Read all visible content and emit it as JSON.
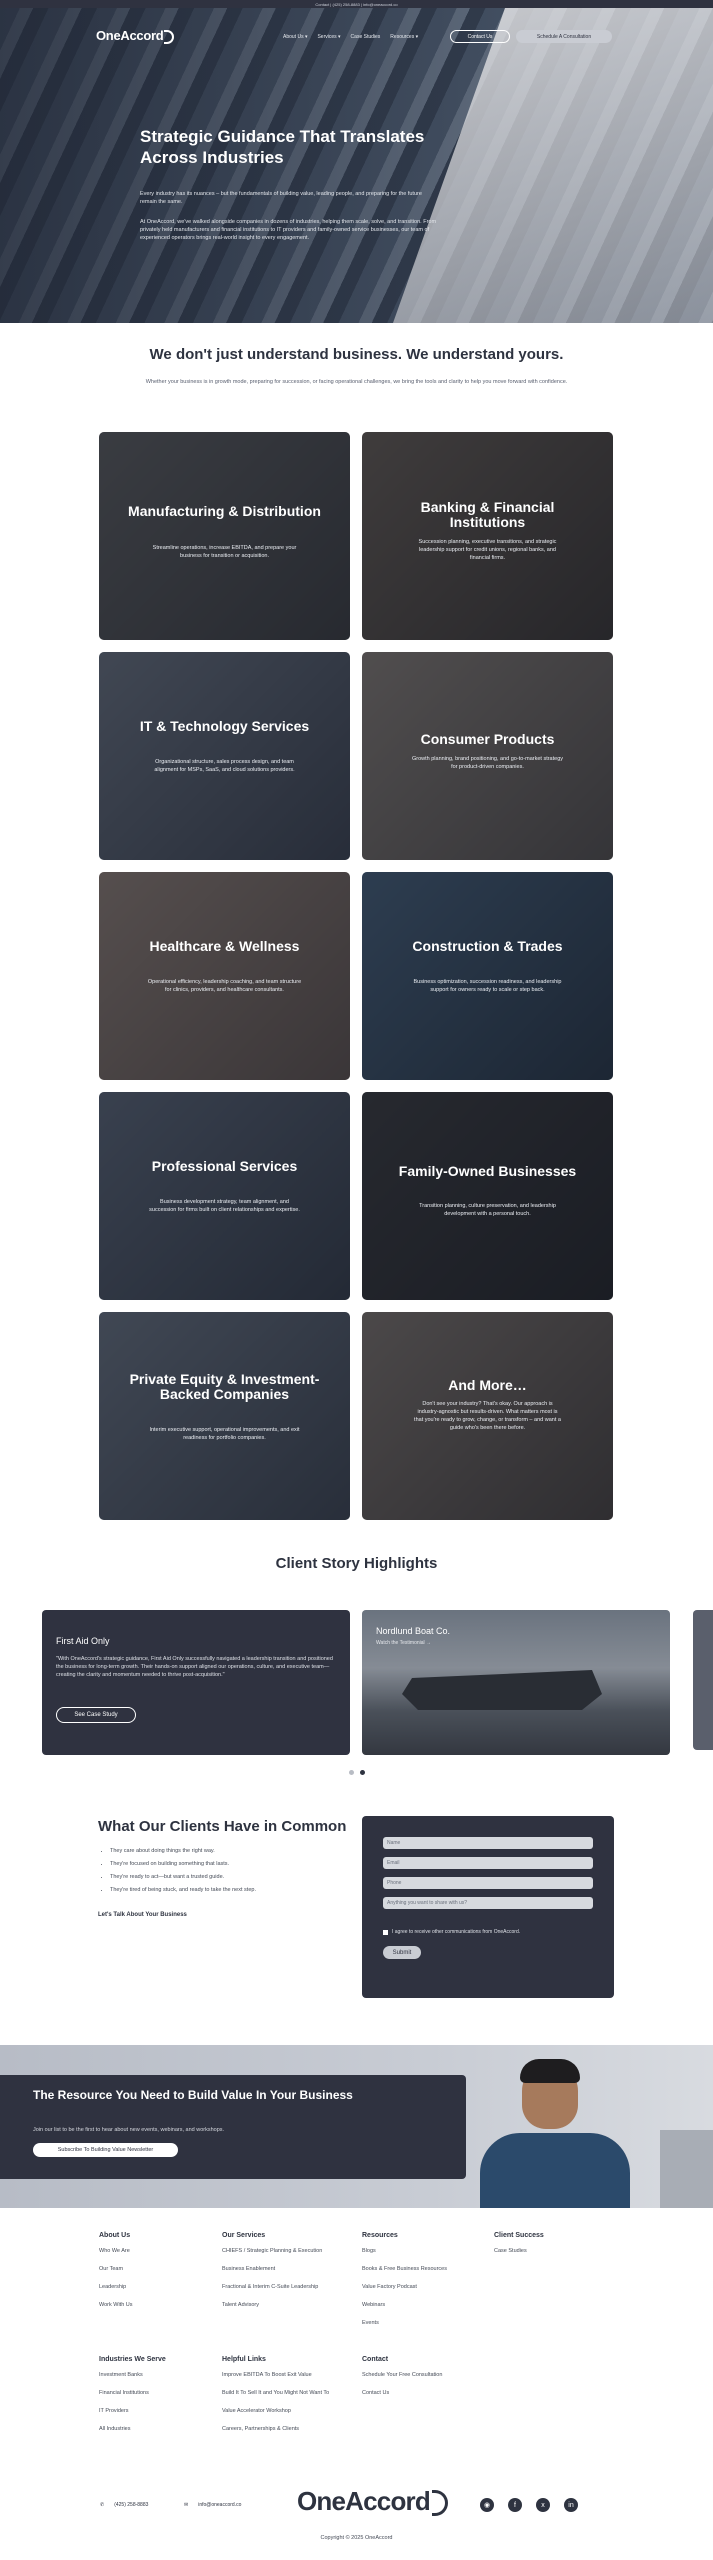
{
  "topbar": {
    "text": "Contact | (425) 258-8883 | info@oneaccord.co"
  },
  "nav": {
    "logo": "OneAccord",
    "links": [
      "About Us ▾",
      "Services ▾",
      "Case Studies",
      "Resources ▾"
    ],
    "contact_label": "Contact Us",
    "schedule_label": "Schedule A Consultation"
  },
  "hero": {
    "title": "Strategic Guidance That Translates Across Industries",
    "p1": "Every industry has its nuances – but the fundamentals of building value, leading people, and preparing for the future remain the same.",
    "p2": "At OneAccord, we've walked alongside companies in dozens of industries, helping them scale, solve, and transition. From privately held manufacturers and financial institutions to IT providers and family-owned service businesses, our team of experienced operators brings real-world insight to every engagement."
  },
  "intro": {
    "title": "We don't just understand business. We understand yours.",
    "text": "Whether your business is in growth mode, preparing for succession, or facing operational challenges, we bring the tools and clarity to help you move forward with confidence."
  },
  "industries": [
    {
      "title": "Manufacturing & Distribution",
      "desc": "Streamline operations, increase EBITDA, and prepare your business for transition or acquisition."
    },
    {
      "title": "Banking & Financial Institutions",
      "desc": "Succession planning, executive transitions, and strategic leadership support for credit unions, regional banks, and financial firms."
    },
    {
      "title": "IT & Technology Services",
      "desc": "Organizational structure, sales process design, and team alignment for MSPs, SaaS, and cloud solutions providers."
    },
    {
      "title": "Consumer Products",
      "desc": "Growth planning, brand positioning, and go-to-market strategy for product-driven companies."
    },
    {
      "title": "Healthcare & Wellness",
      "desc": "Operational efficiency, leadership coaching, and team structure for clinics, providers, and healthcare consultants."
    },
    {
      "title": "Construction & Trades",
      "desc": "Business optimization, succession readiness, and leadership support for owners ready to scale or step back."
    },
    {
      "title": "Professional Services",
      "desc": "Business development strategy, team alignment, and succession for firms built on client relationships and expertise."
    },
    {
      "title": "Family-Owned Businesses",
      "desc": "Transition planning, culture preservation, and leadership development with a personal touch."
    },
    {
      "title": "Private Equity & Investment-Backed Companies",
      "desc": "Interim executive support, operational improvements, and exit readiness for portfolio companies."
    },
    {
      "title": "And More…",
      "desc": "Don't see your industry? That's okay. Our approach is industry-agnostic but results-driven. What matters most is that you're ready to grow, change, or transform – and want a guide who's been there before."
    }
  ],
  "client_stories": {
    "title": "Client Story Highlights",
    "card1": {
      "name": "First Aid Only",
      "quote": "\"With OneAccord's strategic guidance, First Aid Only successfully navigated a leadership transition and positioned the business for long-term growth. Their hands-on support aligned our operations, culture, and executive team—creating the clarity and momentum needed to thrive post-acquisition.\"",
      "button": "See Case Study"
    },
    "card2": {
      "name": "Nordlund Boat Co.",
      "sub": "Watch the Testimonial →"
    }
  },
  "common": {
    "title": "What Our Clients Have in Common",
    "items": [
      "They care about doing things the right way.",
      "They're focused on building something that lasts.",
      "They're ready to act—but want a trusted guide.",
      "They're tired of being stuck, and ready to take the next step."
    ],
    "link": "Let's Talk About Your Business"
  },
  "form": {
    "fields": [
      "Name",
      "Email",
      "Phone",
      "Anything you want to share with us?"
    ],
    "consent": "I agree to receive other communications from OneAccord.",
    "submit": "Submit"
  },
  "newsletter": {
    "title": "The Resource You Need to Build Value In Your Business",
    "text": "Join our list to be the first to hear about new events, webinars, and workshops.",
    "button": "Subscribe To Building Value Newsletter"
  },
  "footer": {
    "about": {
      "title": "About Us",
      "items": [
        "Who We Are",
        "Our Team",
        "Leadership",
        "Work With Us"
      ]
    },
    "services": {
      "title": "Our Services",
      "items": [
        "CHIEFS / Strategic Planning & Execution",
        "Business Enablement",
        "Fractional & Interim C-Suite Leadership",
        "Talent Advisory"
      ]
    },
    "resources": {
      "title": "Resources",
      "items": [
        "Blogs",
        "Books & Free Business Resources",
        "Value Factory Podcast",
        "Webinars",
        "Events"
      ]
    },
    "success": {
      "title": "Client Success",
      "items": [
        "Case Studies"
      ]
    },
    "industries": {
      "title": "Industries We Serve",
      "items": [
        "Investment Banks",
        "Financial Institutions",
        "IT Providers",
        "All Industries"
      ]
    },
    "helpful": {
      "title": "Helpful Links",
      "items": [
        "Improve EBITDA To Boost Exit Value",
        "Build It To Sell It and You Might Not Want To",
        "Value Accelerator Workshop",
        "Careers, Partnerships & Clients"
      ]
    },
    "contact": {
      "title": "Contact",
      "items": [
        "Schedule Your Free Consultation",
        "Contact Us"
      ]
    },
    "phone": "(425) 258-8883",
    "email": "info@oneaccord.co",
    "logo": "OneAccord",
    "copyright": "Copyright © 2025 OneAccord"
  }
}
